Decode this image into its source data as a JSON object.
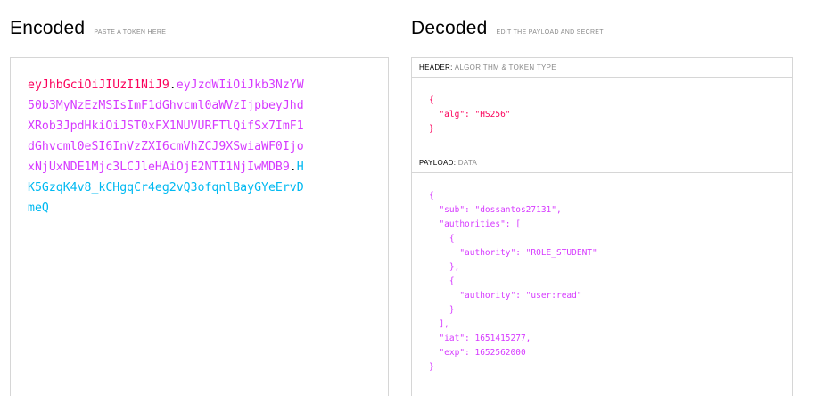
{
  "encoded": {
    "title": "Encoded",
    "subtitle": "PASTE A TOKEN HERE",
    "token_lines": [
      [
        {
          "t": "eyJhbGciOiJIUzI1NiJ9",
          "c": "header"
        },
        {
          "t": ".",
          "c": "dot"
        },
        {
          "t": "eyJzdWIiOiJkb3NzYW",
          "c": "payload"
        }
      ],
      [
        {
          "t": "50b3MyNzEzMSIsImF1dGhvcml0aWVzIjpbeyJhd",
          "c": "payload"
        }
      ],
      [
        {
          "t": "XRob3JpdHkiOiJST0xFX1NUVURFTlQifSx7ImF1",
          "c": "payload"
        }
      ],
      [
        {
          "t": "dGhvcml0eSI6InVzZXI6cmVhZCJ9XSwiaWF0Ijo",
          "c": "payload"
        }
      ],
      [
        {
          "t": "xNjUxNDE1Mjc3LCJleHAiOjE2NTI1NjIwMDB9",
          "c": "payload"
        },
        {
          "t": ".",
          "c": "dot"
        },
        {
          "t": "H",
          "c": "sig"
        }
      ],
      [
        {
          "t": "K5GzqK4v8_kCHgqCr4eg2vQ3ofqnlBayGYeErvD",
          "c": "sig"
        }
      ],
      [
        {
          "t": "meQ",
          "c": "sig"
        }
      ]
    ]
  },
  "decoded": {
    "title": "Decoded",
    "subtitle": "EDIT THE PAYLOAD AND SECRET",
    "header_label": "HEADER:",
    "header_desc": "ALGORITHM & TOKEN TYPE",
    "payload_label": "PAYLOAD:",
    "payload_desc": "DATA",
    "header_lines": [
      [
        {
          "t": "{",
          "c": "red"
        }
      ],
      [
        {
          "t": "  \"alg\": \"HS256\"",
          "c": "red"
        }
      ],
      [
        {
          "t": "}",
          "c": "red"
        }
      ]
    ],
    "payload_lines": [
      [
        {
          "t": "{",
          "c": "purple"
        }
      ],
      [
        {
          "t": "  \"sub\": \"dossantos27131\",",
          "c": "purple"
        }
      ],
      [
        {
          "t": "  \"authorities\": [",
          "c": "purple"
        }
      ],
      [
        {
          "t": "    {",
          "c": "purple"
        }
      ],
      [
        {
          "t": "      \"authority\": \"ROLE_STUDENT\"",
          "c": "purple"
        }
      ],
      [
        {
          "t": "    },",
          "c": "purple"
        }
      ],
      [
        {
          "t": "    {",
          "c": "purple"
        }
      ],
      [
        {
          "t": "      \"authority\": \"user:read\"",
          "c": "purple"
        }
      ],
      [
        {
          "t": "    }",
          "c": "purple"
        }
      ],
      [
        {
          "t": "  ],",
          "c": "purple"
        }
      ],
      [
        {
          "t": "  \"iat\": 1651415277,",
          "c": "purple"
        }
      ],
      [
        {
          "t": "  \"exp\": 1652562000",
          "c": "purple"
        }
      ],
      [
        {
          "t": "}",
          "c": "purple"
        }
      ]
    ]
  }
}
